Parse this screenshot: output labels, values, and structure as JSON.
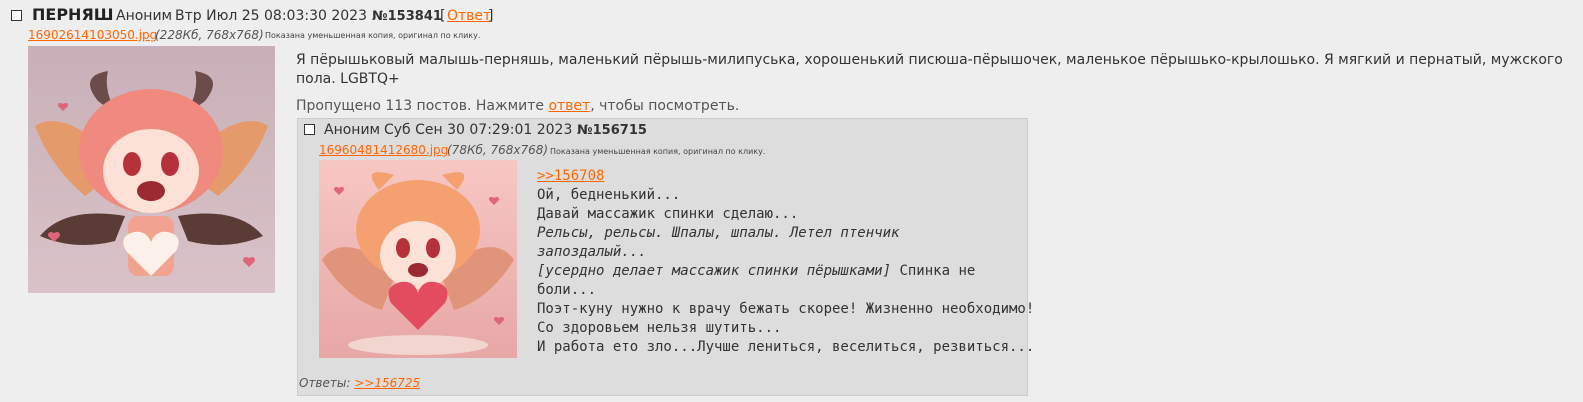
{
  "op": {
    "subject": "ПЕРНЯШ",
    "author": "Аноним",
    "date": "Втр Июл 25 08:03:30 2023",
    "number": "№153841",
    "reply_bracket_open": "[",
    "reply_label": "Ответ",
    "reply_bracket_close": "]",
    "file": {
      "name": "16902614103050.jpg",
      "info": "(228Кб, 768x768)",
      "hint": "Показана уменьшенная копия, оригинал по клику."
    },
    "message_line1": "Я пёрышьковый малышь-перняшь, маленький пёрышь-милипуська, хорошенький писюша-пёрышочек, маленькое пёрышько-крылошько. Я мягкий и пернатый, мужского",
    "message_line2": "пола. LGBTQ+",
    "omitted_pre": "Пропущено 113 постов. Нажмите ",
    "omitted_link": "ответ",
    "omitted_post": ", чтобы посмотреть."
  },
  "reply": {
    "author": "Аноним",
    "date": "Суб Сен 30 07:29:01 2023",
    "number": "№156715",
    "file": {
      "name": "16960481412680.jpg",
      "info": "(78Кб, 768x768)",
      "hint": "Показана уменьшенная копия, оригинал по клику."
    },
    "quote_link": ">>156708",
    "lines": [
      "Ой, бедненький...",
      "Давай массажик спинки сделаю...",
      "Рельсы, рельсы. Шпалы, шпалы. Летел птенчик",
      "запоздалый...",
      "[усердно делает массажик спинки пёрышками]",
      " Спинка не",
      "боли...",
      "Поэт-куну нужно к врачу бежать скорее! Жизненно необходимо!",
      "Со здоровьем нельзя шутить...",
      "И работа ето зло...Лучше лениться, веселиться, резвиться..."
    ],
    "replies_label": "Ответы: ",
    "replies_link": ">>156725"
  },
  "colors": {
    "background": "#eeeeee",
    "reply_background": "#dddddd",
    "link": "#ff6600",
    "text": "#333333"
  }
}
